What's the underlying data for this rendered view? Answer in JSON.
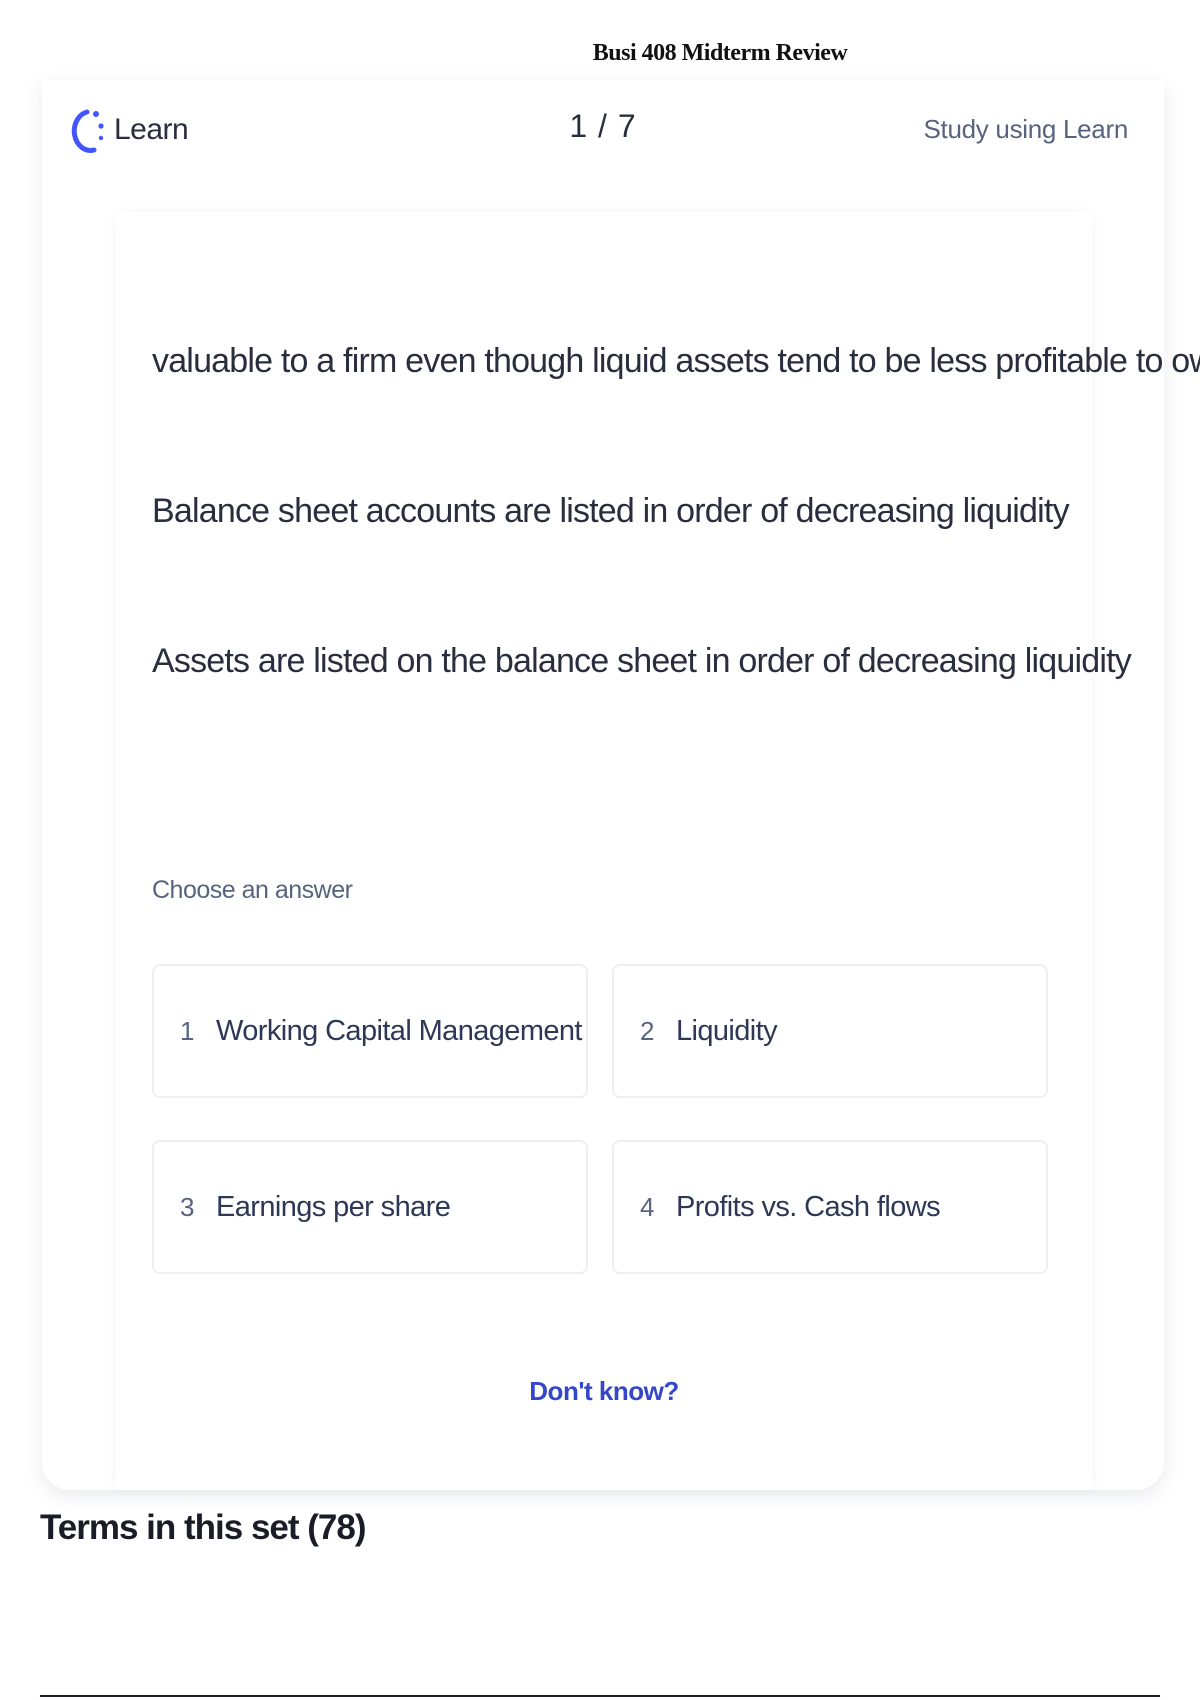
{
  "document": {
    "title": "Busi 408 Midterm Review"
  },
  "header": {
    "brand_label": "Learn",
    "progress": "1 / 7",
    "study_link": "Study using Learn"
  },
  "question": {
    "term_lines": [
      "valuable to a firm even though liquid assets tend to be less profitable to own",
      "Balance sheet accounts are listed in order of decreasing liquidity",
      "Assets are listed on the balance sheet in order of decreasing liquidity"
    ],
    "prompt": "Choose an answer",
    "options": [
      {
        "number": "1",
        "label": "Working Capital Management"
      },
      {
        "number": "2",
        "label": "Liquidity"
      },
      {
        "number": "3",
        "label": "Earnings per share"
      },
      {
        "number": "4",
        "label": "Profits vs. Cash flows"
      }
    ],
    "dont_know": "Don't know?"
  },
  "terms": {
    "heading": "Terms in this set (78)"
  },
  "colors": {
    "accent": "#3547c9",
    "brand_icon": "#4255ff",
    "text_primary": "#282e3e",
    "text_secondary": "#586380",
    "option_border": "#edeff4"
  },
  "icons": {
    "brand": "learn-progress-circle-icon"
  }
}
